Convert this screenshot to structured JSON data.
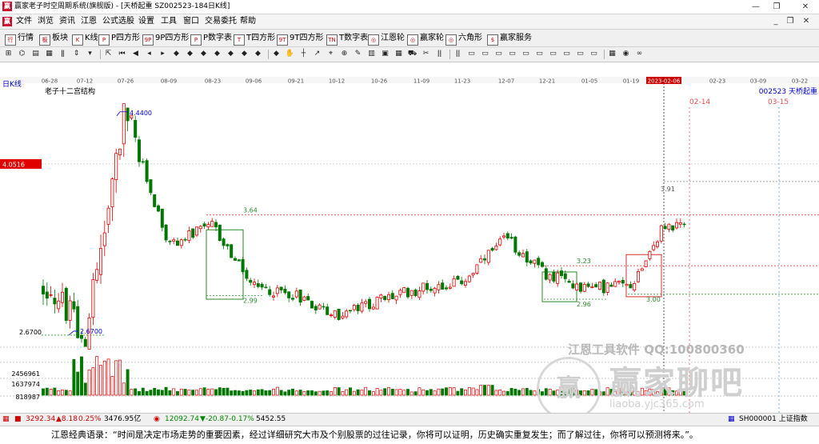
{
  "window": {
    "title": "赢家老子时空周期系统(旗舰版) - [天桥起重  SZ002523-184日K线]",
    "minimize": "—",
    "maximize": "❐",
    "close": "✕"
  },
  "menu": {
    "logo": "赢",
    "items": [
      "文件",
      "浏览",
      "资讯",
      "江恩",
      "公式选股",
      "设置",
      "工具",
      "窗口",
      "交易委托",
      "帮助"
    ],
    "mdi": {
      "minimize": "_",
      "restore": "❐",
      "close": "✕"
    }
  },
  "toolbar1": [
    {
      "icon": "行",
      "label": "行情"
    },
    {
      "icon": "板",
      "label": "板块"
    },
    {
      "icon": "K",
      "label": "K线"
    },
    {
      "icon": "P",
      "label": "P四方形"
    },
    {
      "icon": "9P",
      "label": "9P四方形"
    },
    {
      "icon": "P",
      "label": "P数字表"
    },
    {
      "icon": "T",
      "label": "T四方形"
    },
    {
      "icon": "9T",
      "label": "9T四方形"
    },
    {
      "icon": "TN",
      "label": "T数字表"
    },
    {
      "icon": "◎",
      "label": "江恩轮"
    },
    {
      "icon": "◎",
      "label": "赢家轮"
    },
    {
      "icon": "◎",
      "label": "六角形"
    },
    {
      "icon": "$",
      "label": "赢家服务"
    }
  ],
  "toolbar2": {
    "icons": [
      "grid-icon",
      "chart-icon",
      "table-icon",
      "doc-icon",
      "candle-icon",
      "up-down-icon",
      "dropdown-icon",
      "arrow-icon",
      "first-icon",
      "prev-icon",
      "left-icon",
      "right-icon",
      "diamond-icon",
      "diamond-icon",
      "diamond-icon",
      "diamond-icon",
      "diamond-icon",
      "diamond-icon",
      "diamond-icon",
      "diamond-icon",
      "hand-icon",
      "cross-icon",
      "angle-icon",
      "label-icon",
      "zoom-icon",
      "draw-icon",
      "book-icon",
      "save-icon",
      "calendar-icon",
      "car-icon",
      "tools-icon",
      "fibo-icon",
      "fibo-icon",
      "box-icon",
      "box-icon",
      "box-icon",
      "box-icon",
      "box-icon",
      "box-icon",
      "box-icon",
      "box-icon",
      "box-icon",
      "box-icon",
      "grid-icon",
      "color-icon",
      "infinity-icon"
    ],
    "glyphs": [
      "⊞",
      "⌬",
      "▤",
      "▦",
      "ǁ",
      "⇕",
      "▾",
      "⇱",
      "⏮",
      "◀",
      "◂",
      "▸",
      "◆",
      "◆",
      "◆",
      "◆",
      "◆",
      "◆",
      "◆",
      "◆",
      "✋",
      "┼",
      "↗",
      "⌖",
      "⊕",
      "✎",
      "▥",
      "▣",
      "▦",
      "⛟",
      "✂",
      "ǀǀ",
      "ǀǀ",
      "▭",
      "▭",
      "▭",
      "▭",
      "▭",
      "▭",
      "▭",
      "▭",
      "▭",
      "▭",
      "▦",
      "◉",
      "∞"
    ]
  },
  "chart": {
    "period_label": "日K线",
    "indicator_title": "老子十二宫结构",
    "stock_label": "002523  天桥起重",
    "date_labels": [
      "06-28",
      "07-12",
      "07-26",
      "08-09",
      "08-23",
      "09-06",
      "09-21",
      "10-12",
      "10-26",
      "11-09",
      "11-23",
      "12-07",
      "12-21",
      "01-05",
      "01-19",
      "2023-02-06",
      "02-23",
      "03-09",
      "03-22"
    ],
    "highlight_date": "2023-02-06",
    "current_price_tag": "4.0516",
    "low_price_tag": "2.6700",
    "volume_labels": [
      "2456961",
      "1637974",
      "818987"
    ],
    "peak_label": "4.4400",
    "low_label": "2.6700",
    "box1": {
      "top_label": "3.64",
      "bottom_label": "2.99"
    },
    "box2": {
      "top_label": "3.23",
      "bottom_label": "2.96"
    },
    "box3": {
      "top_label": "3.91",
      "bottom_label": "3.00"
    },
    "future_date1": "02-14",
    "future_date2": "03-15",
    "colors": {
      "up": "#e00000",
      "down": "#007700",
      "dashed_red": "#e05050",
      "dashed_green": "#30a030",
      "box": "#2a8a2a",
      "blue": "#0000cc"
    }
  },
  "chart_data": {
    "type": "candlestick",
    "title": "老子十二宫结构",
    "xlabel": "",
    "ylabel": "",
    "ylim": [
      2.45,
      4.6
    ],
    "x": [
      "06-28",
      "07-12",
      "07-26",
      "08-09",
      "08-23",
      "09-06",
      "09-21",
      "10-12",
      "10-26",
      "11-09",
      "11-23",
      "12-07",
      "12-21",
      "01-05",
      "01-19",
      "2023-02-06"
    ],
    "series": [
      {
        "name": "",
        "anchors": [
          {
            "x": "06-28",
            "y": 3.05
          },
          {
            "x": "07-12",
            "y": 2.67
          },
          {
            "x": "07-26",
            "y": 4.44
          },
          {
            "x": "08-09",
            "y": 3.4
          },
          {
            "x": "08-23",
            "y": 3.55
          },
          {
            "x": "09-06",
            "y": 3.05
          },
          {
            "x": "09-21",
            "y": 3.0
          },
          {
            "x": "10-12",
            "y": 2.82
          },
          {
            "x": "10-26",
            "y": 2.95
          },
          {
            "x": "11-09",
            "y": 3.05
          },
          {
            "x": "11-23",
            "y": 3.1
          },
          {
            "x": "12-07",
            "y": 3.45
          },
          {
            "x": "12-21",
            "y": 3.15
          },
          {
            "x": "01-05",
            "y": 3.05
          },
          {
            "x": "01-19",
            "y": 3.08
          },
          {
            "x": "2023-02-06",
            "y": 3.55
          }
        ]
      }
    ],
    "price_levels": [
      4.0516,
      3.64,
      3.23,
      3.91,
      3.0,
      2.99,
      2.96,
      2.67
    ],
    "volume_axis": [
      818987,
      1637974,
      2456961
    ]
  },
  "status": {
    "sh_index": "3292.34",
    "sh_change": "▲8.18",
    "sh_pct": "0.25%",
    "sh_amount": "3476.95亿",
    "sz_index": "12092.74",
    "sz_change": "▼-20.87",
    "sz_pct": "-0.17%",
    "sz_amount": "5452.55",
    "right_label": "SH000001 上证指数"
  },
  "quote": "江恩经典语录：“时间是决定市场走势的重要因素，经过详细研究大市及个别股票的过往记录，你将可以证明，历史确实重复发生；而了解过往，你将可以预测将来。”。",
  "watermark": {
    "text": "江恩工具软件   QQ:100800360",
    "logo": "赢家聊吧",
    "circle": "赢",
    "sub": "liaoba.yjc365.com"
  }
}
